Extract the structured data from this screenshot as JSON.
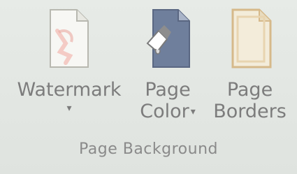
{
  "group": {
    "label": "Page Background",
    "buttons": {
      "watermark": {
        "label": "Watermark",
        "arrow": "▾",
        "icon": "watermark-icon"
      },
      "page_color": {
        "line1": "Page",
        "line2": "Color",
        "arrow": "▾",
        "icon": "page-color-icon"
      },
      "page_borders": {
        "line1": "Page",
        "line2": "Borders",
        "icon": "page-borders-icon"
      }
    }
  }
}
